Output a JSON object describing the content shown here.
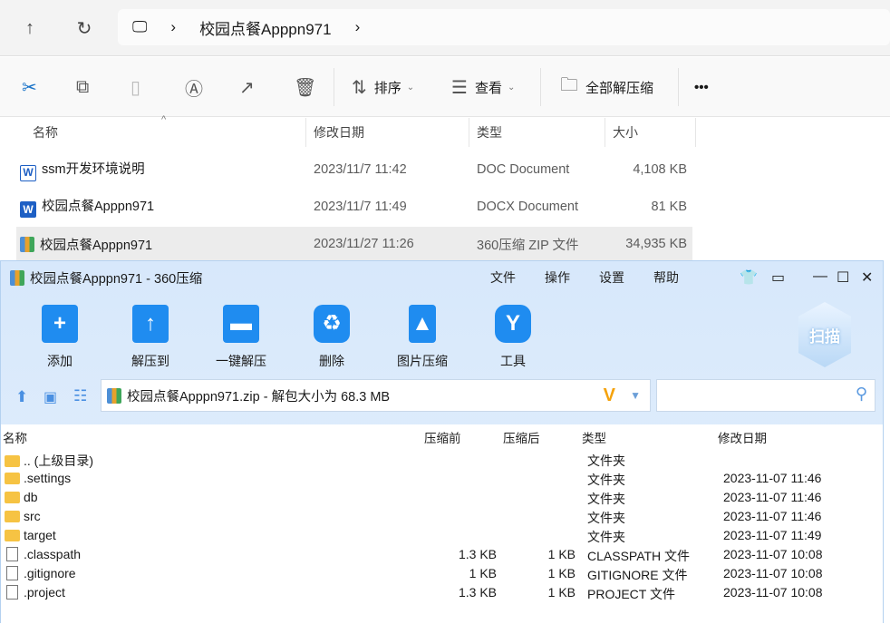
{
  "explorer": {
    "breadcrumb": "校园点餐Apppn971",
    "toolbar": {
      "sort": "排序",
      "view": "查看",
      "extract_all": "全部解压缩",
      "more": "•••"
    },
    "columns": [
      "名称",
      "修改日期",
      "类型",
      "大小"
    ],
    "files": [
      {
        "name": "ssm开发环境说明",
        "date": "2023/11/7 11:42",
        "type": "DOC Document",
        "size": "4,108 KB",
        "icon": "word-doc-icon"
      },
      {
        "name": "校园点餐Apppn971",
        "date": "2023/11/7 11:49",
        "type": "DOCX Document",
        "size": "81 KB",
        "icon": "word-docx-icon"
      },
      {
        "name": "校园点餐Apppn971",
        "date": "2023/11/27 11:26",
        "type": "360压缩 ZIP 文件",
        "size": "34,935 KB",
        "icon": "zip-icon"
      }
    ]
  },
  "zip": {
    "title": "校园点餐Apppn971 - 360压缩",
    "menu": [
      "文件",
      "操作",
      "设置",
      "帮助"
    ],
    "tools": [
      "添加",
      "解压到",
      "一键解压",
      "删除",
      "图片压缩",
      "工具"
    ],
    "scan": "扫描",
    "path": "校园点餐Apppn971.zip - 解包大小为 68.3 MB",
    "columns": [
      "名称",
      "压缩前",
      "压缩后",
      "类型",
      "修改日期"
    ],
    "rows": [
      {
        "name": ".. (上级目录)",
        "before": "",
        "after": "",
        "type": "文件夹",
        "date": "",
        "folder": true
      },
      {
        "name": ".settings",
        "before": "",
        "after": "",
        "type": "文件夹",
        "date": "2023-11-07 11:46",
        "folder": true
      },
      {
        "name": "db",
        "before": "",
        "after": "",
        "type": "文件夹",
        "date": "2023-11-07 11:46",
        "folder": true
      },
      {
        "name": "src",
        "before": "",
        "after": "",
        "type": "文件夹",
        "date": "2023-11-07 11:46",
        "folder": true
      },
      {
        "name": "target",
        "before": "",
        "after": "",
        "type": "文件夹",
        "date": "2023-11-07 11:49",
        "folder": true
      },
      {
        "name": ".classpath",
        "before": "1.3 KB",
        "after": "1 KB",
        "type": "CLASSPATH 文件",
        "date": "2023-11-07 10:08",
        "folder": false
      },
      {
        "name": ".gitignore",
        "before": "1 KB",
        "after": "1 KB",
        "type": "GITIGNORE 文件",
        "date": "2023-11-07 10:08",
        "folder": false
      },
      {
        "name": ".project",
        "before": "1.3 KB",
        "after": "1 KB",
        "type": "PROJECT 文件",
        "date": "2023-11-07 10:08",
        "folder": false
      }
    ]
  }
}
